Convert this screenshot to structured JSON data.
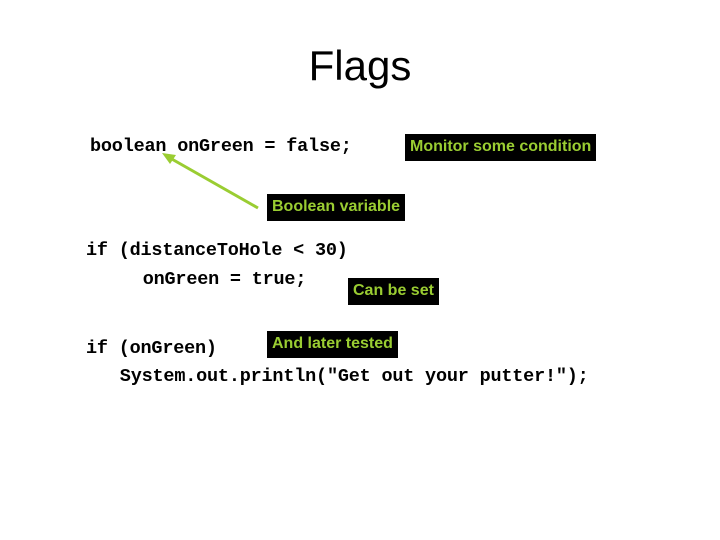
{
  "slide": {
    "title": "Flags",
    "code": {
      "declaration": "boolean onGreen = false;",
      "if_distance": "if (distanceToHole < 30)",
      "assign_true": "   onGreen = true;",
      "if_ongreen": "if (onGreen)",
      "println": "  System.out.println(\"Get out your putter!\");"
    },
    "callouts": {
      "monitor": "Monitor some condition",
      "boolean_variable": "Boolean variable",
      "can_be_set": "Can be set",
      "later_tested": "And later tested"
    },
    "colors": {
      "callout_background": "#000000",
      "callout_text": "#9acd32",
      "arrow": "#9acd32"
    }
  }
}
